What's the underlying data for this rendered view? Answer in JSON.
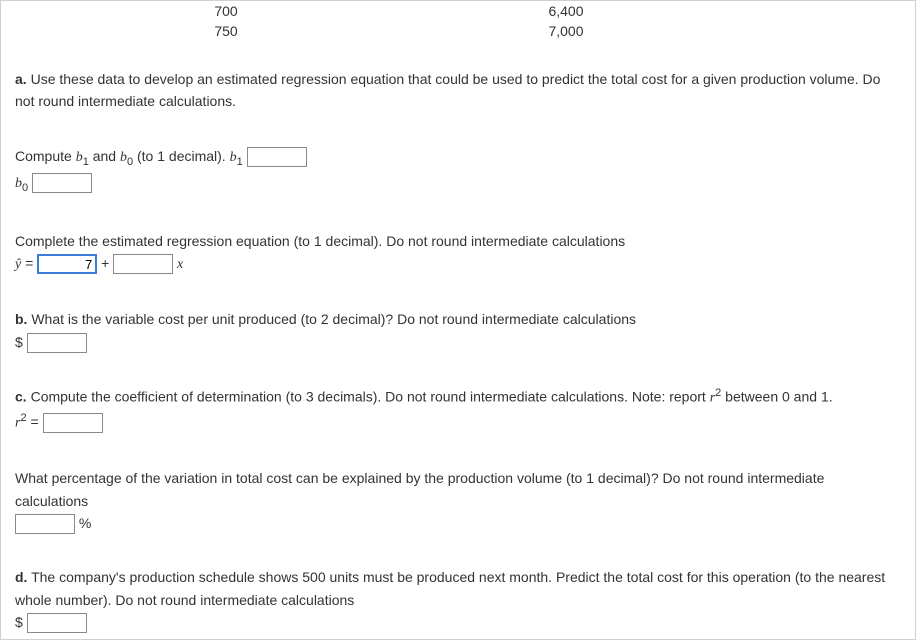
{
  "table": {
    "rows": [
      {
        "c1": "700",
        "c2": "6,400"
      },
      {
        "c1": "750",
        "c2": "7,000"
      }
    ]
  },
  "a": {
    "label": "a.",
    "text": "Use these data to develop an estimated regression equation that could be used to predict the total cost for a given production volume. Do not round intermediate calculations.",
    "compute_pre": "Compute ",
    "b1": "b",
    "b1sub": "1",
    "and": " and ",
    "b0": "b",
    "b0sub": "0",
    "to1": " (to ",
    "one": "1",
    "dec": " decimal). ",
    "complete": "Complete the estimated regression equation (to ",
    "compl2": " decimal). Do not round intermediate calculations",
    "yhat": "ŷ",
    "eq": " = ",
    "plus": " + ",
    "x": "x",
    "b1_field_value": "7"
  },
  "b": {
    "label": "b.",
    "text_pre": "What is the variable cost per unit produced (to ",
    "two": "2",
    "text_post": " decimal)? Do not round intermediate calculations",
    "dollar": "$"
  },
  "c": {
    "label": "c.",
    "text_pre": "Compute the coefficient of determination (to ",
    "three": "3",
    "text_mid": " decimals). Do not round intermediate calculations. Note: report ",
    "r": "r",
    "sq": "2",
    "between": " between ",
    "zero": "0",
    "and": " and ",
    "one": "1",
    "period": ".",
    "eq": " = ",
    "pct_pre": "What percentage of the variation in total cost can be explained by the production volume (to ",
    "pct_one": "1",
    "pct_post": " decimal)? Do not round intermediate calculations",
    "pct": "%"
  },
  "d": {
    "label": "d.",
    "text_pre": "The company's production schedule shows ",
    "n500": "500",
    "text_post": " units must be produced next month. Predict the total cost for this operation (to the nearest whole number). Do not round intermediate calculations",
    "dollar": "$"
  }
}
